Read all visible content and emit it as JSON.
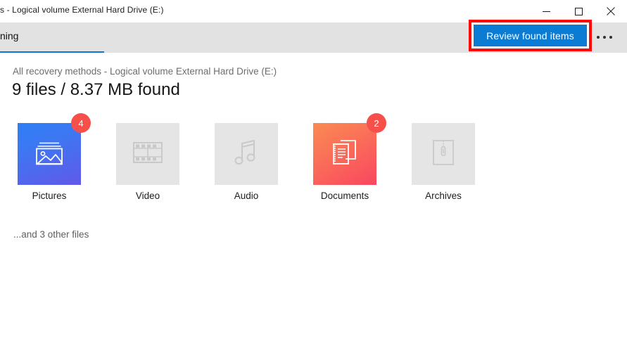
{
  "window": {
    "title": "s - Logical volume External Hard Drive (E:)",
    "controls": {
      "minimize": "minimize-button",
      "maximize": "maximize-button",
      "close": "close-button"
    }
  },
  "command_bar": {
    "tab_label": "ning",
    "primary_button": "Review found items",
    "overflow_label": "More options",
    "accent_color": "#0a7cd4",
    "highlight_color": "#fb0a08",
    "band_color": "#e2e2e2"
  },
  "main": {
    "subtitle": "All recovery methods - Logical volume External Hard Drive (E:)",
    "headline": "9 files / 8.37 MB found",
    "other_files": "...and 3 other files",
    "tiles": [
      {
        "label": "Pictures",
        "badge": "4",
        "active": true,
        "icon": "picture-icon",
        "gradient_from": "#2f7ef5",
        "gradient_to": "#6159e8"
      },
      {
        "label": "Video",
        "badge": "",
        "active": false,
        "icon": "film-strip-icon",
        "gradient_from": "#e5e5e5",
        "gradient_to": "#e5e5e5"
      },
      {
        "label": "Audio",
        "badge": "",
        "active": false,
        "icon": "music-note-icon",
        "gradient_from": "#e5e5e5",
        "gradient_to": "#e5e5e5"
      },
      {
        "label": "Documents",
        "badge": "2",
        "active": true,
        "icon": "documents-icon",
        "gradient_from": "#fa8a52",
        "gradient_to": "#f9465f"
      },
      {
        "label": "Archives",
        "badge": "",
        "active": false,
        "icon": "archive-zip-icon",
        "gradient_from": "#e5e5e5",
        "gradient_to": "#e5e5e5"
      }
    ]
  }
}
